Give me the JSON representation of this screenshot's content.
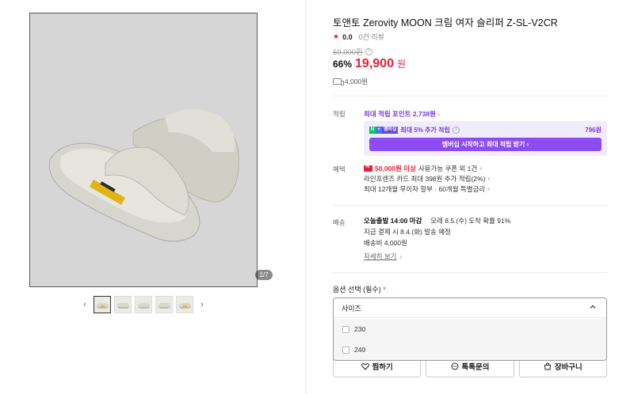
{
  "gallery": {
    "counter": "1/7",
    "prev_arrow": "‹",
    "next_arrow": "›",
    "thumbnails": [
      "thumb-1",
      "thumb-2",
      "thumb-3",
      "thumb-4",
      "thumb-5"
    ]
  },
  "product": {
    "title": "토앤토 Zerovity MOON 크림 여자 슬리퍼 Z-SL-V2CR",
    "rating_star": "★",
    "rating": "0.0",
    "review_count": "0건 리뷰",
    "original_price": "59,000원",
    "discount": "66%",
    "sale_price": "19,900",
    "sale_unit": "원",
    "shipping_fee": "4,000원"
  },
  "points": {
    "label": "적립",
    "max_points": "최대 적립 포인트 2,738원",
    "member_badge_text": "멤버십",
    "member_text": "최대 5% 추가 적립",
    "member_amount": "796원",
    "member_button": "멤버십 시작하고 최대 적립 받기"
  },
  "benefits": {
    "label": "혜택",
    "coupon_strong": "50,000원 이상",
    "coupon_rest": "사용가능 쿠폰 외 1건",
    "card": "라인프렌즈 카드 최대 398원 추가 적립(2%)",
    "installment": "최대 12개월 무이자 할부 · 60개월 특별금리"
  },
  "delivery": {
    "label": "배송",
    "deadline_strong": "오늘출발 14:00 마감",
    "arrival": "모레 8.5.(수) 도착 확률 91%",
    "pay_now": "지금 결제 시 8.4.(화) 발송 예정",
    "fee": "배송비 4,000원",
    "details": "자세히 보기"
  },
  "options": {
    "label": "옵션 선택 (필수)",
    "required_mark": "*",
    "select_value": "사이즈",
    "items": [
      "230",
      "240"
    ]
  },
  "actions": {
    "wish": "찜하기",
    "talk": "톡톡문의",
    "cart": "장바구니"
  },
  "colors": {
    "accent_red": "#e5203b",
    "accent_purple": "#8d4cf2"
  }
}
